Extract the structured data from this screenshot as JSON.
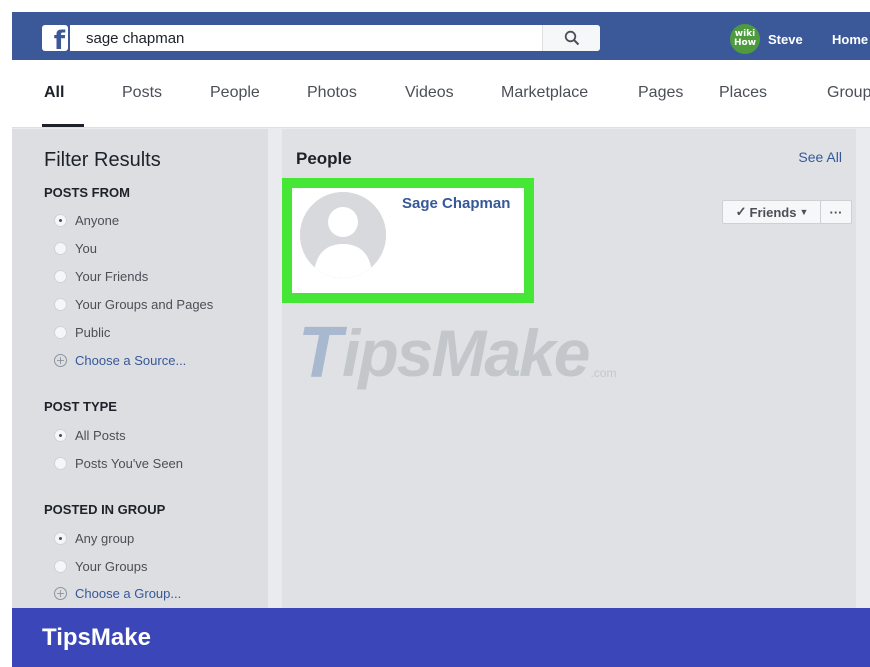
{
  "header": {
    "logo_letter": "f",
    "search": {
      "value": "sage chapman",
      "placeholder": "Search"
    },
    "avatar_text_top": "wiki",
    "avatar_text_bottom": "How",
    "user_name": "Steve",
    "home_label": "Home"
  },
  "tabs": [
    {
      "label": "All",
      "active": true
    },
    {
      "label": "Posts"
    },
    {
      "label": "People"
    },
    {
      "label": "Photos"
    },
    {
      "label": "Videos"
    },
    {
      "label": "Marketplace"
    },
    {
      "label": "Pages"
    },
    {
      "label": "Places"
    },
    {
      "label": "Groups"
    }
  ],
  "filters": {
    "title": "Filter Results",
    "posts_from": {
      "heading": "POSTS FROM",
      "options": [
        "Anyone",
        "You",
        "Your Friends",
        "Your Groups and Pages",
        "Public"
      ],
      "selected": "Anyone",
      "link": "Choose a Source..."
    },
    "post_type": {
      "heading": "POST TYPE",
      "options": [
        "All Posts",
        "Posts You've Seen"
      ],
      "selected": "All Posts"
    },
    "posted_in_group": {
      "heading": "POSTED IN GROUP",
      "options": [
        "Any group",
        "Your Groups"
      ],
      "selected": "Any group",
      "link": "Choose a Group..."
    }
  },
  "results": {
    "section_title": "People",
    "see_all": "See All",
    "person": {
      "name": "Sage Chapman",
      "friends_button": "Friends",
      "more_button": "···"
    }
  },
  "watermark": {
    "first": "T",
    "rest": "ipsMake",
    "suffix": ".com"
  },
  "brand": "TipsMake",
  "colors": {
    "facebook_blue": "#3b5998",
    "highlight_green": "#45e635",
    "brand_bar": "#3b47b9",
    "link_blue": "#365899"
  }
}
